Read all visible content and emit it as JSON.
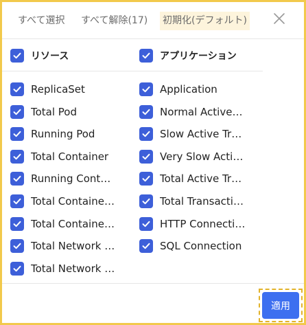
{
  "header": {
    "select_all": "すべて選択",
    "deselect_all": "すべて解除(17)",
    "reset": "初期化(デフォルト)"
  },
  "columns": {
    "resource_title": "リソース",
    "application_title": "アプリケーション"
  },
  "resource_items": [
    {
      "label": "ReplicaSet",
      "checked": true
    },
    {
      "label": "Total Pod",
      "checked": true
    },
    {
      "label": "Running Pod",
      "checked": true
    },
    {
      "label": "Total Container",
      "checked": true
    },
    {
      "label": "Running Container",
      "checked": true
    },
    {
      "label": "Total Container ...",
      "checked": true
    },
    {
      "label": "Total Container ...",
      "checked": true
    },
    {
      "label": "Total Network R...",
      "checked": true
    },
    {
      "label": "Total Network Tr...",
      "checked": true
    }
  ],
  "application_items": [
    {
      "label": "Application",
      "checked": true
    },
    {
      "label": "Normal Active Tr...",
      "checked": true
    },
    {
      "label": "Slow Active Tran...",
      "checked": true
    },
    {
      "label": "Very Slow Active...",
      "checked": true
    },
    {
      "label": "Total Active Tran...",
      "checked": true
    },
    {
      "label": "Total Transaction",
      "checked": true
    },
    {
      "label": "HTTP Connection",
      "checked": true
    },
    {
      "label": "SQL Connection",
      "checked": true
    }
  ],
  "footer": {
    "apply_label": "適用"
  },
  "colors": {
    "accent": "#3d5fd9",
    "apply_button": "#3d6ff0",
    "highlight_border": "#f2c94c"
  }
}
